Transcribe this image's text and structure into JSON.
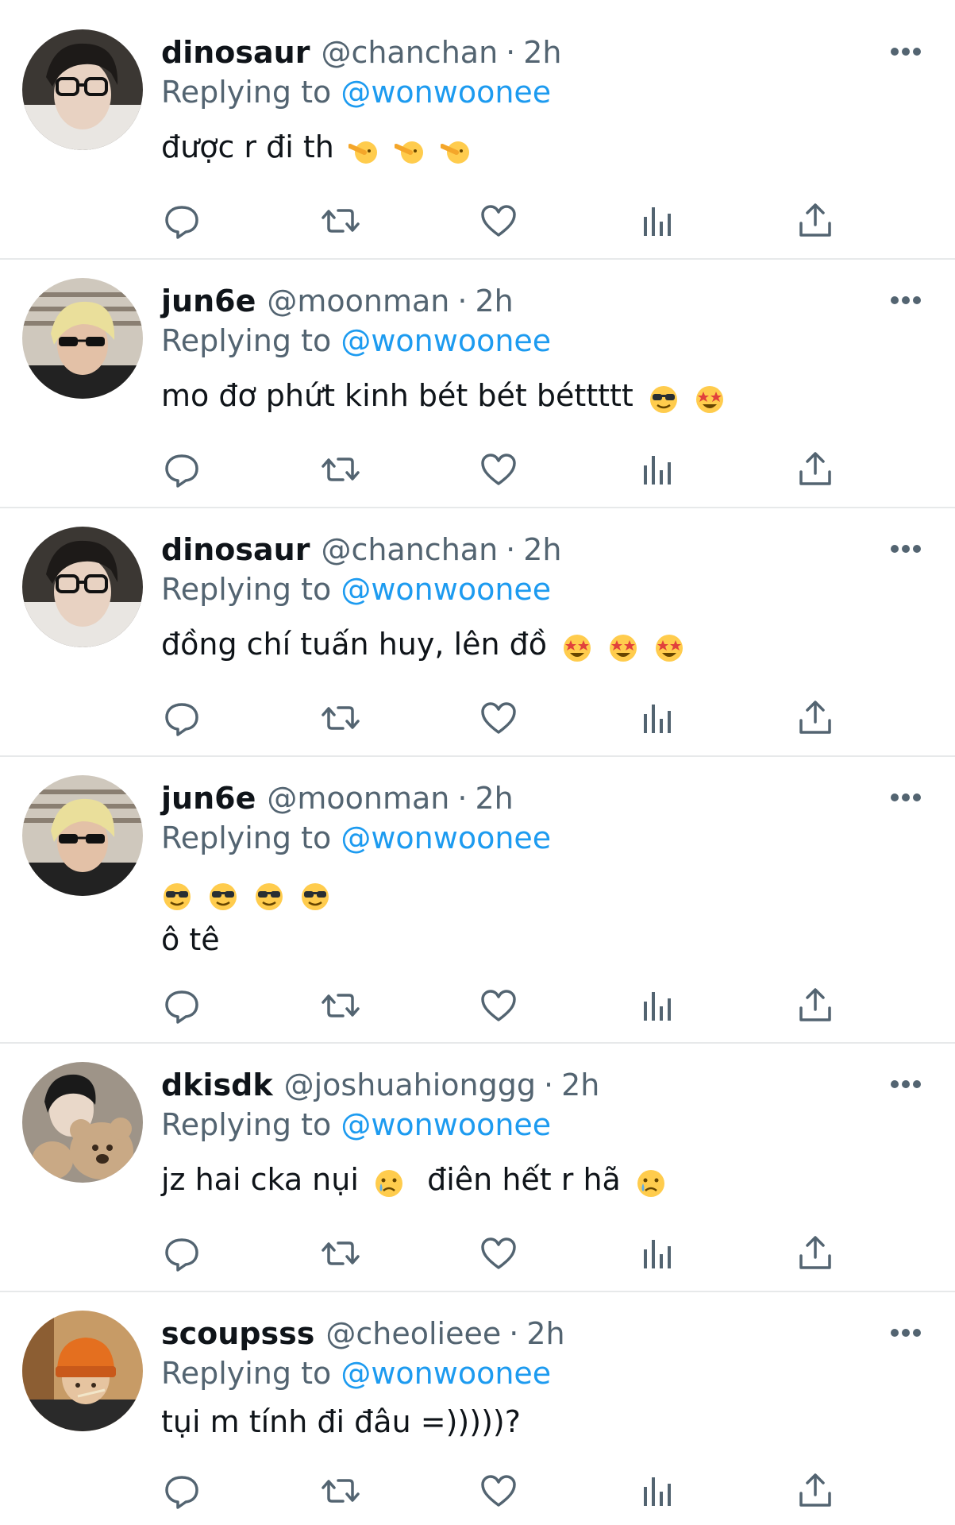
{
  "reply_prefix": "Replying to",
  "tweets": [
    {
      "display_name": "dinosaur",
      "handle": "@chanchan",
      "separator": "·",
      "time": "2h",
      "replying_to": "@wonwoonee",
      "text_lines": [
        "được r đi th"
      ],
      "emojis": [
        "saluting-face",
        "saluting-face",
        "saluting-face"
      ],
      "avatar": "glasses-dark-hair"
    },
    {
      "display_name": "jun6e",
      "handle": "@moonman",
      "separator": "·",
      "time": "2h",
      "replying_to": "@wonwoonee",
      "text_lines": [
        "mo đơ phứt kinh bét bét béttttt"
      ],
      "emojis": [
        "sunglasses-face",
        "star-struck-face"
      ],
      "avatar": "blond-sunglasses"
    },
    {
      "display_name": "dinosaur",
      "handle": "@chanchan",
      "separator": "·",
      "time": "2h",
      "replying_to": "@wonwoonee",
      "text_lines": [
        "đồng chí tuấn huy, lên đồ"
      ],
      "emojis": [
        "star-struck-face",
        "star-struck-face",
        "star-struck-face"
      ],
      "avatar": "glasses-dark-hair"
    },
    {
      "display_name": "jun6e",
      "handle": "@moonman",
      "separator": "·",
      "time": "2h",
      "replying_to": "@wonwoonee",
      "text_lines": [
        "",
        "ô tê"
      ],
      "emojis": [
        "sunglasses-face",
        "sunglasses-face",
        "sunglasses-face",
        "sunglasses-face"
      ],
      "avatar": "blond-sunglasses"
    },
    {
      "display_name": "dkisdk",
      "handle": "@joshuahionggg",
      "separator": "·",
      "time": "2h",
      "replying_to": "@wonwoonee",
      "text_lines": [
        "jz hai cka nụi",
        "điên hết r hã"
      ],
      "emojis": [
        "crying-face",
        "crying-face"
      ],
      "avatar": "teddy-bear"
    },
    {
      "display_name": "scoupsss",
      "handle": "@cheolieee",
      "separator": "·",
      "time": "2h",
      "replying_to": "@wonwoonee",
      "text_lines": [
        "tụi m tính đi đâu =)))))?"
      ],
      "emojis": [],
      "avatar": "orange-beanie"
    }
  ],
  "icons": {
    "reply": "reply-icon",
    "retweet": "retweet-icon",
    "like": "heart-icon",
    "views": "views-icon",
    "share": "share-icon",
    "more": "more-icon"
  },
  "colors": {
    "text": "#0f1419",
    "secondary": "#536471",
    "link": "#1d9bf0",
    "divider": "#e7e9ea"
  }
}
